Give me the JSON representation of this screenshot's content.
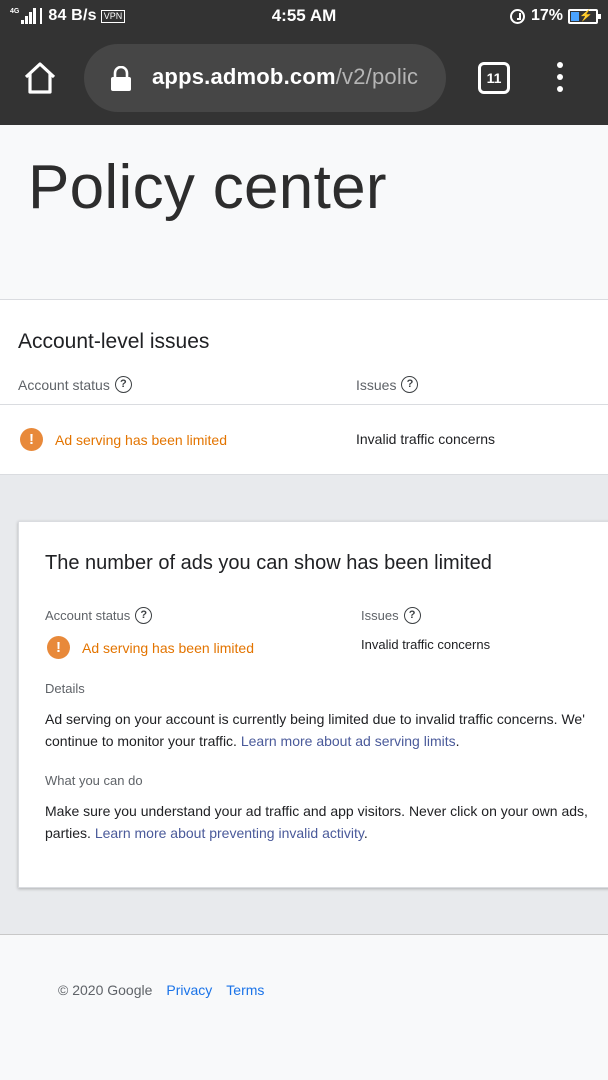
{
  "status_bar": {
    "network": "4G",
    "speed": "84  B/s",
    "vpn": "VPN",
    "time": "4:55 AM",
    "battery_pct": "17%",
    "battery_level": 0.17
  },
  "browser": {
    "url_domain": "apps.admob.com",
    "url_path": "/v2/polic",
    "tab_count": "11"
  },
  "page": {
    "title": "Policy center"
  },
  "account_issues": {
    "title": "Account-level issues",
    "status_label": "Account status",
    "issues_label": "Issues",
    "status_value": "Ad serving has been limited",
    "issue_value": "Invalid traffic concerns",
    "help_glyph": "?"
  },
  "detail": {
    "title": "The number of ads you can show has been limited",
    "status_label": "Account status",
    "issues_label": "Issues",
    "status_value": "Ad serving has been limited",
    "issue_value": "Invalid traffic concerns",
    "details_label": "Details",
    "details_line1": "Ad serving on your account is currently being limited due to invalid traffic concerns. We'",
    "details_line2_text": "continue to monitor your traffic. ",
    "details_link": "Learn more about ad serving limits",
    "details_end": ".",
    "what_label": "What you can do",
    "what_line1": "Make sure you understand your ad traffic and app visitors. Never click on your own ads,",
    "what_line2_text": "parties. ",
    "what_link": "Learn more about preventing invalid activity",
    "what_end": "."
  },
  "footer": {
    "copyright": "© 2020 Google",
    "privacy": "Privacy",
    "terms": "Terms"
  },
  "colors": {
    "toolbar": "#333333",
    "warning": "#e8893a",
    "link": "#1a73e8"
  }
}
